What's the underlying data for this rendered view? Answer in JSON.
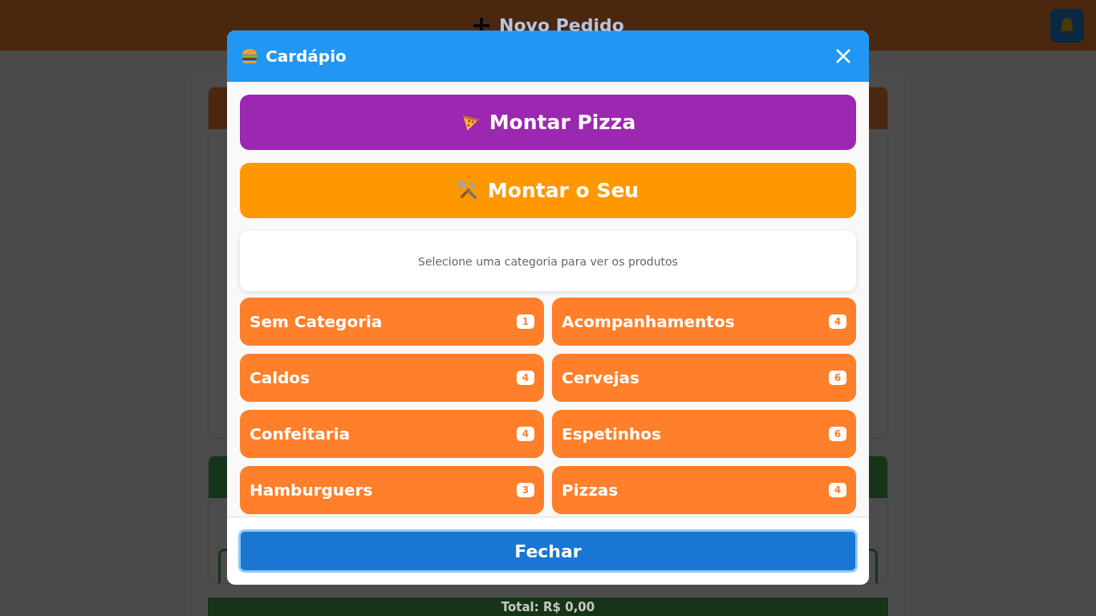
{
  "header": {
    "title": "Novo Pedido"
  },
  "order_total": "Total: R$ 0,00",
  "modal": {
    "title": "Cardápio",
    "actions": [
      {
        "label": "Montar Pizza",
        "kind": "pizza"
      },
      {
        "label": "Montar o Seu",
        "kind": "custom"
      }
    ],
    "hint": "Selecione uma categoria para ver os produtos",
    "categories": [
      {
        "name": "Sem Categoria",
        "count": "1"
      },
      {
        "name": "Acompanhamentos",
        "count": "4"
      },
      {
        "name": "Caldos",
        "count": "4"
      },
      {
        "name": "Cervejas",
        "count": "6"
      },
      {
        "name": "Confeitaria",
        "count": "4"
      },
      {
        "name": "Espetinhos",
        "count": "6"
      },
      {
        "name": "Hamburguers",
        "count": "3"
      },
      {
        "name": "Pizzas",
        "count": "4"
      }
    ],
    "close_button": "Fechar"
  }
}
